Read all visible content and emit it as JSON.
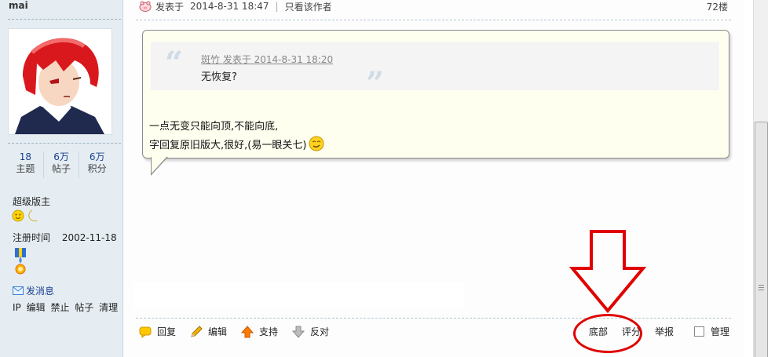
{
  "user": {
    "name": "mai",
    "stats": [
      {
        "num": "18",
        "label": "主题"
      },
      {
        "num": "6万",
        "label": "帖子"
      },
      {
        "num": "6万",
        "label": "积分"
      }
    ],
    "rank": "超级版主",
    "reg_label": "注册时间",
    "reg_date": "2002-11-18",
    "send_message": "发消息",
    "admin_links": [
      "IP",
      "编辑",
      "禁止",
      "帖子",
      "清理"
    ]
  },
  "post": {
    "posted_label": "发表于",
    "posted_time": "2014-8-31 18:47",
    "only_author": "只看该作者",
    "floor": "72楼",
    "quote": {
      "author_line": "斑竹 发表于 2014-8-31 18:20",
      "text": "无恢复?"
    },
    "body_lines": [
      "一点无变只能向顶,不能向底,",
      "字回复原旧版大,很好,(易一眼关七)"
    ]
  },
  "actions": {
    "reply": "回复",
    "edit": "编辑",
    "support": "支持",
    "oppose": "反对",
    "bottom": "底部",
    "rate": "评分",
    "report": "举报",
    "manage": "管理"
  },
  "colors": {
    "sidebar_bg": "#e5edf2",
    "bubble_bg": "#fffff0",
    "annotation_red": "#e00000"
  }
}
